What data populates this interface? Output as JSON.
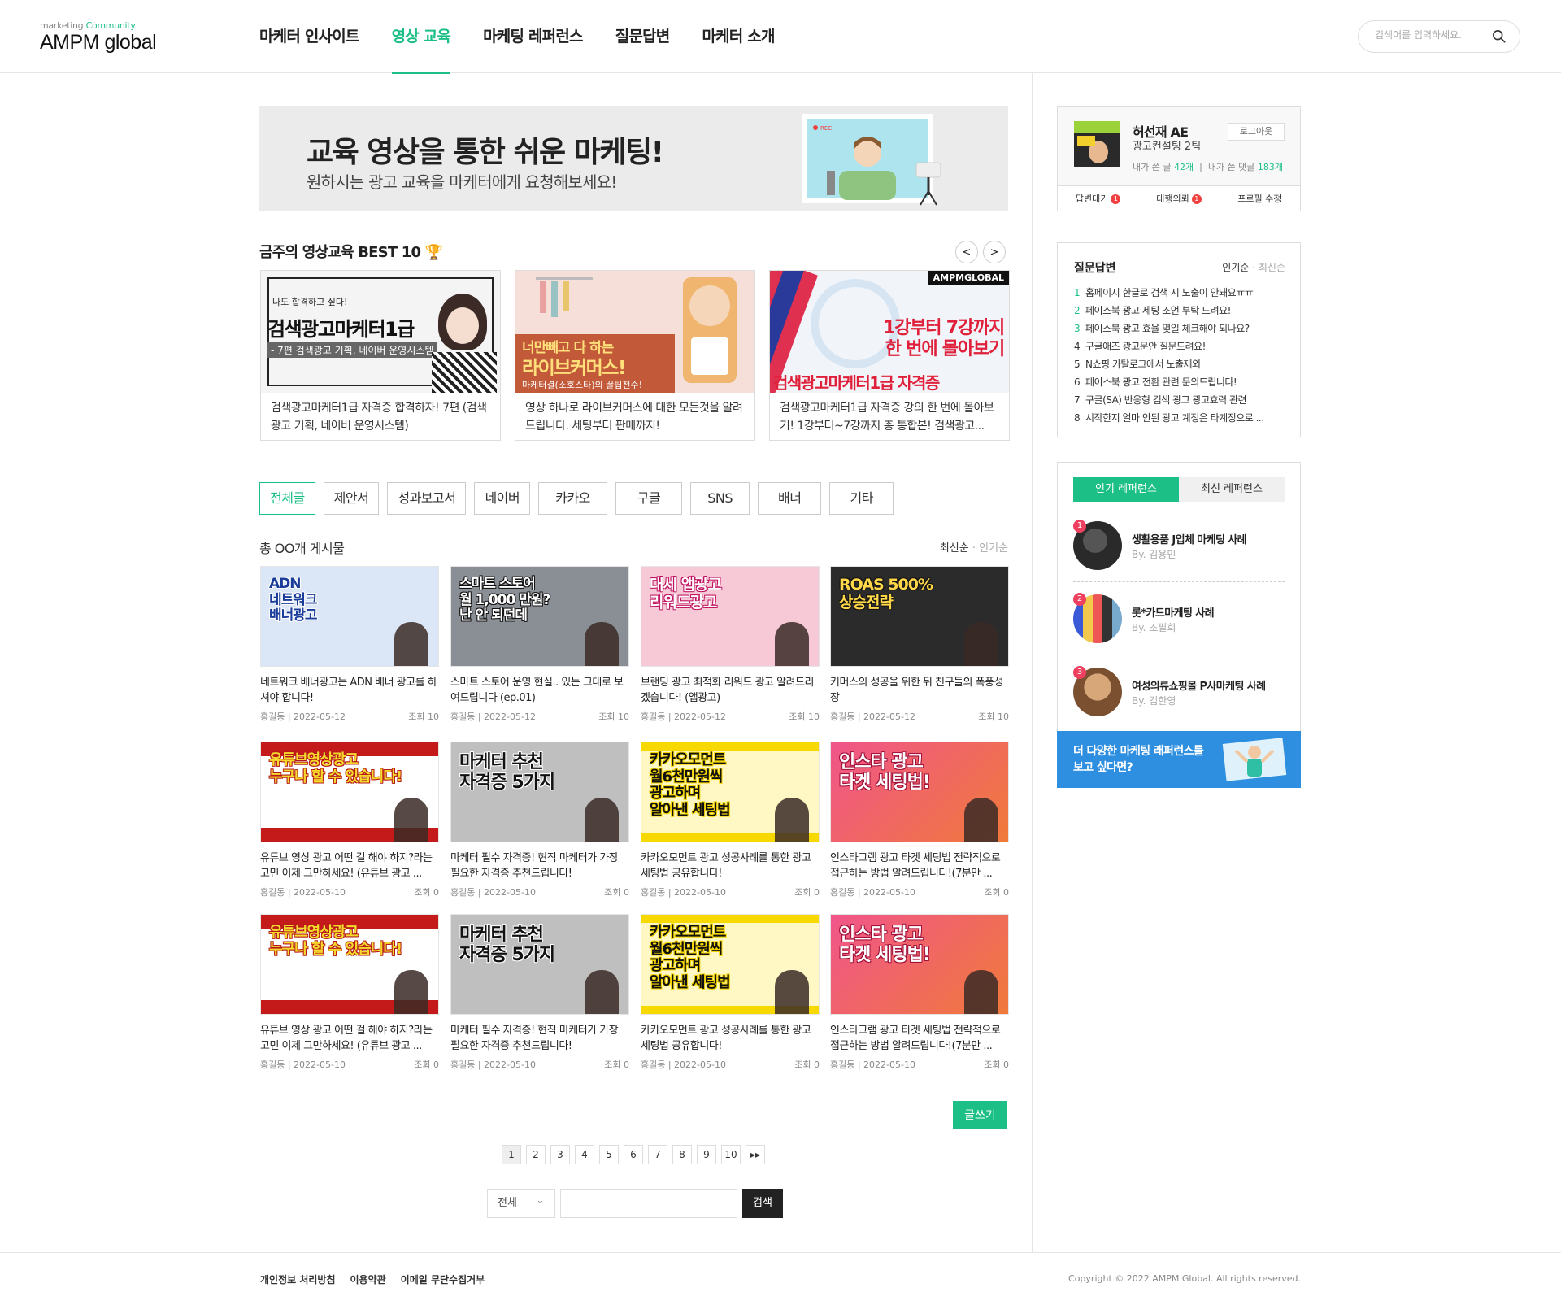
{
  "brand": {
    "small_prefix": "marketing",
    "small_accent": "Community",
    "name": "AMPM global"
  },
  "nav": [
    {
      "label": "마케터 인사이트",
      "active": false
    },
    {
      "label": "영상 교육",
      "active": true
    },
    {
      "label": "마케팅 레퍼런스",
      "active": false
    },
    {
      "label": "질문답변",
      "active": false
    },
    {
      "label": "마케터 소개",
      "active": false
    }
  ],
  "search": {
    "placeholder": "검색어를 입력하세요."
  },
  "hero": {
    "title": "교육 영상을 통한 쉬운 마케팅!",
    "subtitle": "원하시는 광고 교육을 마케터에게 요청해보세요!",
    "rec_label": "REC"
  },
  "best": {
    "title": "금주의 영상교육 BEST 10 🏆",
    "prev": "<",
    "next": ">",
    "items": [
      {
        "caption": "검색광고마케터1급 자격증 합격하자! 7편 (검색광고 기획, 네이버 운영시스템)",
        "art_top": "나도 합격하고 싶다!",
        "art_main": "검색광고마케터1급",
        "art_sub": "- 7편 검색광고 기획, 네이버 운영시스템"
      },
      {
        "caption": "영상 하나로 라이브커머스에 대한 모든것을 알려드립니다. 세팅부터 판매까지!",
        "art_top": "너만빼고 다 하는",
        "art_main": "라이브커머스!",
        "art_sub": "마케터결(소호스타)의 꿀팁전수!"
      },
      {
        "caption": "검색광고마케터1급 자격증 강의 한 번에 몰아보기! 1강부터~7강까지 총 통합본! 검색광고...",
        "art_top": "AMPMGLOBAL",
        "art_main": "1강부터 7강까지\n한 번에 몰아보기",
        "art_sub": "검색광고마케터1급 자격증"
      }
    ]
  },
  "categories": [
    {
      "label": "전체글",
      "active": true
    },
    {
      "label": "제안서",
      "active": false
    },
    {
      "label": "성과보고서",
      "active": false
    },
    {
      "label": "네이버",
      "active": false
    },
    {
      "label": "카카오",
      "active": false
    },
    {
      "label": "구글",
      "active": false
    },
    {
      "label": "SNS",
      "active": false
    },
    {
      "label": "배너",
      "active": false
    },
    {
      "label": "기타",
      "active": false
    }
  ],
  "list": {
    "total": "총 OO개 게시물",
    "sort_active": "최신순",
    "sort_other": "인기순",
    "posts": [
      {
        "title": "네트워크 배너광고는 ADN 배너 광고를 하셔야 합니다!",
        "author": "홍길동",
        "date": "2022-05-12",
        "views": "조회 10",
        "art": "ADN\n네트워크\n배너광고",
        "theme": "adn"
      },
      {
        "title": "스마트 스토어 운영 현실.. 있는 그대로 보여드립니다 (ep.01)",
        "author": "홍길동",
        "date": "2022-05-12",
        "views": "조회 10",
        "art": "스마트 스토어\n월 1,000 만원?\n난 안 되던데",
        "theme": "store"
      },
      {
        "title": "브랜딩 광고 최적화 리워드 광고 알려드리겠습니다! (앱광고)",
        "author": "홍길동",
        "date": "2022-05-12",
        "views": "조회 10",
        "art": "대세 앱광고\n리워드광고",
        "theme": "reward"
      },
      {
        "title": "커머스의 성공을 위한 뒤 친구들의 폭풍성장",
        "author": "홍길동",
        "date": "2022-05-12",
        "views": "조회 10",
        "art": "ROAS 500%\n상승전략",
        "theme": "roas"
      },
      {
        "title": "유튜브 영상 광고 어떤 걸 해야 하지?라는 고민 이제 그만하세요! (유튜브 광고 ...",
        "author": "홍길동",
        "date": "2022-05-10",
        "views": "조회 0",
        "art": "유튜브영상광고\n누구나 할 수 있습니다!",
        "theme": "yt"
      },
      {
        "title": "마케터 필수 자격증! 현직 마케터가 가장 필요한 자격증 추천드립니다!",
        "author": "홍길동",
        "date": "2022-05-10",
        "views": "조회 0",
        "art": "마케터 추천\n자격증 5가지",
        "theme": "cert"
      },
      {
        "title": "카카오모먼트 광고 성공사례를 통한 광고 세팅법 공유합니다!",
        "author": "홍길동",
        "date": "2022-05-10",
        "views": "조회 0",
        "art": "카카오모먼트\n월6천만원씩\n광고하며\n알아낸 세팅법",
        "theme": "kakao"
      },
      {
        "title": "인스타그램 광고 타겟 세팅법 전략적으로 접근하는 방법 알려드립니다!(7분만 ...",
        "author": "홍길동",
        "date": "2022-05-10",
        "views": "조회 0",
        "art": "인스타 광고\n타겟 세팅법!",
        "theme": "insta"
      },
      {
        "title": "유튜브 영상 광고 어떤 걸 해야 하지?라는 고민 이제 그만하세요! (유튜브 광고 ...",
        "author": "홍길동",
        "date": "2022-05-10",
        "views": "조회 0",
        "art": "유튜브영상광고\n누구나 할 수 있습니다!",
        "theme": "yt"
      },
      {
        "title": "마케터 필수 자격증! 현직 마케터가 가장 필요한 자격증 추천드립니다!",
        "author": "홍길동",
        "date": "2022-05-10",
        "views": "조회 0",
        "art": "마케터 추천\n자격증 5가지",
        "theme": "cert"
      },
      {
        "title": "카카오모먼트 광고 성공사례를 통한 광고 세팅법 공유합니다!",
        "author": "홍길동",
        "date": "2022-05-10",
        "views": "조회 0",
        "art": "카카오모먼트\n월6천만원씩\n광고하며\n알아낸 세팅법",
        "theme": "kakao"
      },
      {
        "title": "인스타그램 광고 타겟 세팅법 전략적으로 접근하는 방법 알려드립니다!(7분만 ...",
        "author": "홍길동",
        "date": "2022-05-10",
        "views": "조회 0",
        "art": "인스타 광고\n타겟 세팅법!",
        "theme": "insta"
      }
    ],
    "write": "글쓰기"
  },
  "pagination": [
    "1",
    "2",
    "3",
    "4",
    "5",
    "6",
    "7",
    "8",
    "9",
    "10",
    "▸▸"
  ],
  "board_search": {
    "select": "전체",
    "button": "검색"
  },
  "footer": {
    "links": [
      "개인정보 처리방침",
      "이용약관",
      "이메일 무단수집거부"
    ],
    "copyright": "Copyright © 2022 AMPM Global. All rights reserved."
  },
  "profile": {
    "name": "허선재 AE",
    "team": "광고컨설팅 2팀",
    "posts_label": "내가 쓴 글",
    "posts_count": "42개",
    "comments_label": "내가 쓴 댓글",
    "comments_count": "183개",
    "logout": "로그아웃",
    "actions": [
      {
        "label": "답변대기",
        "badge": "1"
      },
      {
        "label": "대행의뢰",
        "badge": "1"
      },
      {
        "label": "프로필 수정",
        "badge": ""
      }
    ]
  },
  "qna": {
    "title": "질문답변",
    "tab_active": "인기순",
    "tab_other": "최신순",
    "items": [
      "홈페이지 한글로 검색 시 노출이 안돼요ㅠㅠ",
      "페이스북 광고 세팅 조언 부탁 드려요!",
      "페이스북 광고 효율 몇일 체크해야 되나요?",
      "구글애즈 광고문안 질문드려요!",
      "N쇼핑 카탈로그에서 노출제외",
      "페이스북 광고 전환 관련 문의드립니다!",
      "구글(SA) 반응형 검색 광고 광고효력 관련",
      "시작한지 얼마 안된 광고 계정은 타계정으로 ..."
    ]
  },
  "reference": {
    "tab_active": "인기 레퍼런스",
    "tab_other": "최신 레퍼런스",
    "items": [
      {
        "rank": "1",
        "name": "생활용품 J업체 마케팅 사례",
        "by": "By. 김용민"
      },
      {
        "rank": "2",
        "name": "롯*카드마케팅 사례",
        "by": "By. 조필희"
      },
      {
        "rank": "3",
        "name": "여성의류쇼핑몰 P사마케팅 사례",
        "by": "By. 김한영"
      }
    ],
    "banner": "더 다양한 마케팅 래퍼런스를\n보고 싶다면?"
  },
  "colors": {
    "accent": "#1cbf85",
    "badge": "#f04040",
    "banner": "#2e8fe0"
  }
}
